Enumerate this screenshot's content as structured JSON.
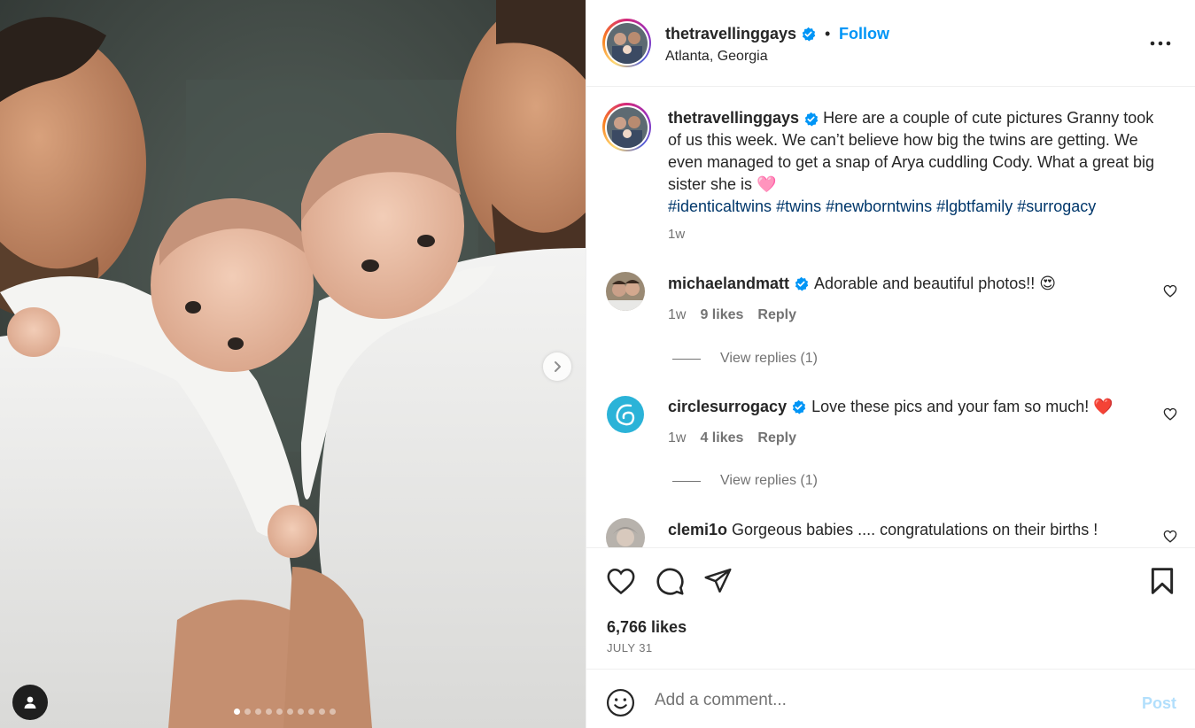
{
  "photo": {
    "description_icon": "tag-user-icon",
    "carousel": {
      "total": 10,
      "active": 1
    }
  },
  "header": {
    "username": "thetravellinggays",
    "bullet": "•",
    "follow_label": "Follow",
    "location": "Atlanta, Georgia"
  },
  "caption": {
    "username": "thetravellinggays",
    "text": "Here are a couple of cute pictures Granny took of us this week. We can’t believe how big the twins are getting. We even managed to get a snap of Arya cuddling Cody. What a great big sister she is 🩷",
    "hashtags": "#identicaltwins #twins #newborntwins #lgbtfamily #surrogacy",
    "time": "1w"
  },
  "comments": [
    {
      "username": "michaelandmatt",
      "verified": true,
      "text": "Adorable and beautiful photos!! 😍",
      "time": "1w",
      "likes": "9 likes",
      "reply_label": "Reply",
      "view_replies": "View replies (1)"
    },
    {
      "username": "circlesurrogacy",
      "verified": true,
      "text": "Love these pics and your fam so much! ❤️",
      "time": "1w",
      "likes": "4 likes",
      "reply_label": "Reply",
      "view_replies": "View replies (1)"
    },
    {
      "username": "clemi1o",
      "verified": false,
      "text": "Gorgeous babies .... congratulations on their births !"
    }
  ],
  "actions": {
    "likes": "6,766 likes",
    "date": "JULY 31"
  },
  "add_comment": {
    "placeholder": "Add a comment...",
    "post_label": "Post"
  },
  "colors": {
    "accent": "#0095f6",
    "hashtag": "#00376b",
    "muted": "#737373",
    "post_disabled": "#b2dffc",
    "heart_red": "#ed4956"
  }
}
